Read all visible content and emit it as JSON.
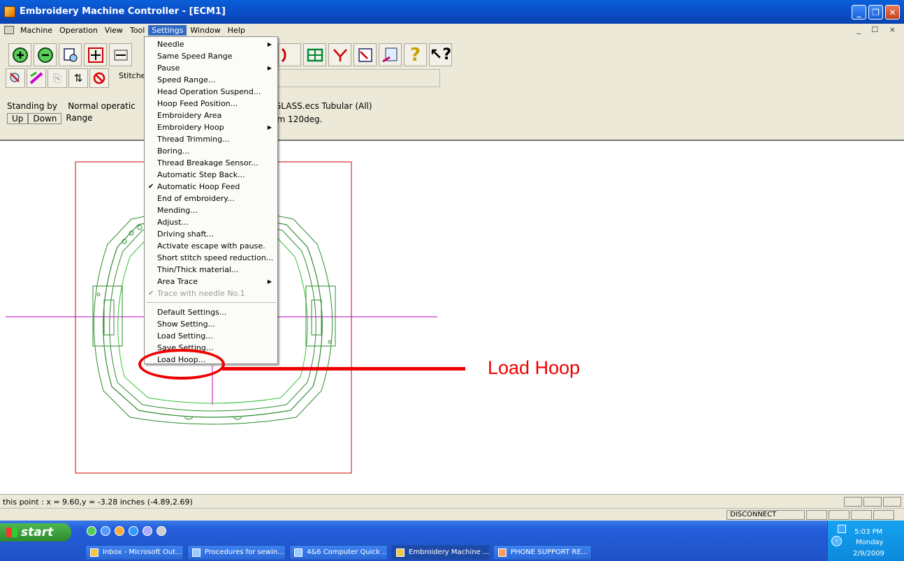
{
  "window": {
    "title": "Embroidery Machine Controller - [ECM1]"
  },
  "menubar": {
    "items": [
      "Machine",
      "Operation",
      "View",
      "Tool",
      "Settings",
      "Window",
      "Help"
    ],
    "active": "Settings",
    "mdi_controls": "_ ☐ ×"
  },
  "toolbar": {
    "stitch_label": "Stitche"
  },
  "status_panel": {
    "line1_state": "Standing by",
    "line1_mode": "Normal operatic",
    "line2_up": "Up",
    "line2_down": "Down",
    "line2_range": "Range",
    "file_info": "NGLASS.ecs Tubular (All)",
    "speed_info": "rpm 120deg."
  },
  "settings_menu": {
    "items": [
      {
        "label": "Needle",
        "submenu": true
      },
      {
        "label": "Same Speed Range"
      },
      {
        "label": "Pause",
        "submenu": true
      },
      {
        "label": "Speed Range..."
      },
      {
        "label": "Head Operation Suspend..."
      },
      {
        "label": "Hoop Feed Position..."
      },
      {
        "label": "Embroidery Area"
      },
      {
        "label": "Embroidery Hoop",
        "submenu": true
      },
      {
        "label": "Thread Trimming..."
      },
      {
        "label": "Boring..."
      },
      {
        "label": "Thread Breakage Sensor..."
      },
      {
        "label": "Automatic Step Back..."
      },
      {
        "label": "Automatic Hoop Feed",
        "checked": true
      },
      {
        "label": "End of embroidery..."
      },
      {
        "label": "Mending..."
      },
      {
        "label": "Adjust..."
      },
      {
        "label": "Driving shaft..."
      },
      {
        "label": "Activate escape with pause."
      },
      {
        "label": "Short stitch speed reduction..."
      },
      {
        "label": "Thin/Thick material..."
      },
      {
        "label": "Area Trace",
        "submenu": true
      },
      {
        "label": "Trace with needle No.1",
        "checked": true,
        "disabled": true
      },
      {
        "separator": true
      },
      {
        "label": "Default Settings..."
      },
      {
        "label": "Show Setting..."
      },
      {
        "label": "Load Setting..."
      },
      {
        "label": "Save Setting..."
      },
      {
        "label": "Load Hoop..."
      }
    ]
  },
  "annotation": {
    "label": "Load Hoop",
    "color": "#e00000"
  },
  "coord_bar": {
    "text": "this point : x = 9.60,y = -3.28 inches (-4.89,2.69)"
  },
  "status_bar": {
    "connection": "DISCONNECT"
  },
  "taskbar": {
    "start_label": "start",
    "tasks": [
      "Inbox - Microsoft Out...",
      "Procedures for sewin...",
      "4&6 Computer Quick ...",
      "Embroidery Machine ...",
      "PHONE SUPPORT RE..."
    ],
    "active_task": 3,
    "clock": {
      "time": "5:03 PM",
      "day": "Monday",
      "date": "2/9/2009"
    }
  },
  "colors": {
    "hoop": "#2e8b2e",
    "hoop_inner": "#39c039",
    "area_rect": "#d00000",
    "crosshair": "#c000c0"
  }
}
